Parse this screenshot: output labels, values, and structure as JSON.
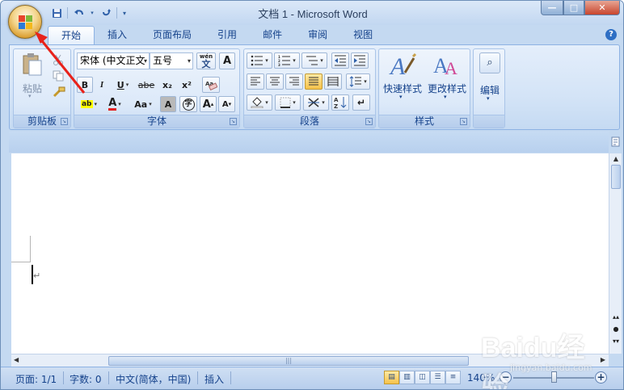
{
  "window": {
    "title": "文档 1 - Microsoft Word"
  },
  "quick_access": {
    "save_icon": "save-icon",
    "undo_icon": "undo-icon",
    "redo_icon": "redo-icon"
  },
  "tabs": [
    {
      "label": "开始",
      "active": true
    },
    {
      "label": "插入"
    },
    {
      "label": "页面布局"
    },
    {
      "label": "引用"
    },
    {
      "label": "邮件"
    },
    {
      "label": "审阅"
    },
    {
      "label": "视图"
    }
  ],
  "ribbon": {
    "clipboard": {
      "label": "剪贴板",
      "paste": "粘贴"
    },
    "font": {
      "label": "字体",
      "font_name": "宋体 (中文正文",
      "font_size": "五号",
      "wen": "wén",
      "wen_char": "文",
      "A_box": "A",
      "bold": "B",
      "italic": "I",
      "underline": "U",
      "strike": "abe",
      "sub": "x₂",
      "sup": "x²",
      "highlight": "ab",
      "font_color": "A",
      "case": "Aa",
      "char_shade": "A",
      "enclose": "字",
      "grow": "A",
      "shrink": "A"
    },
    "paragraph": {
      "label": "段落"
    },
    "styles": {
      "label": "样式",
      "quick": "快速样式",
      "change": "更改样式"
    },
    "editing": {
      "label": "编辑"
    }
  },
  "statusbar": {
    "page": "页面: 1/1",
    "words": "字数: 0",
    "language": "中文(简体，中国)",
    "mode": "插入",
    "zoom": "140%"
  },
  "watermark": {
    "text": "Baidu经验",
    "sub": "jingyan.baidu.com"
  },
  "colors": {
    "accent": "#15428b",
    "annotation": "#e8221b"
  }
}
